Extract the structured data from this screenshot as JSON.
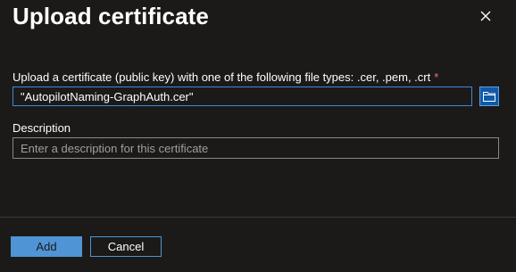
{
  "dialog": {
    "title": "Upload certificate"
  },
  "upload": {
    "label": "Upload a certificate (public key) with one of the following file types: .cer, .pem, .crt",
    "required_mark": "*",
    "value": "\"AutopilotNaming-GraphAuth.cer\""
  },
  "description": {
    "label": "Description",
    "placeholder": "Enter a description for this certificate",
    "value": ""
  },
  "footer": {
    "add_label": "Add",
    "cancel_label": "Cancel"
  },
  "icons": {
    "close": "close-icon",
    "browse": "folder-icon"
  },
  "colors": {
    "background": "#1b1a19",
    "accent": "#4f94d4",
    "required": "#f1707b",
    "input_border_focus": "#3c8ad4"
  }
}
